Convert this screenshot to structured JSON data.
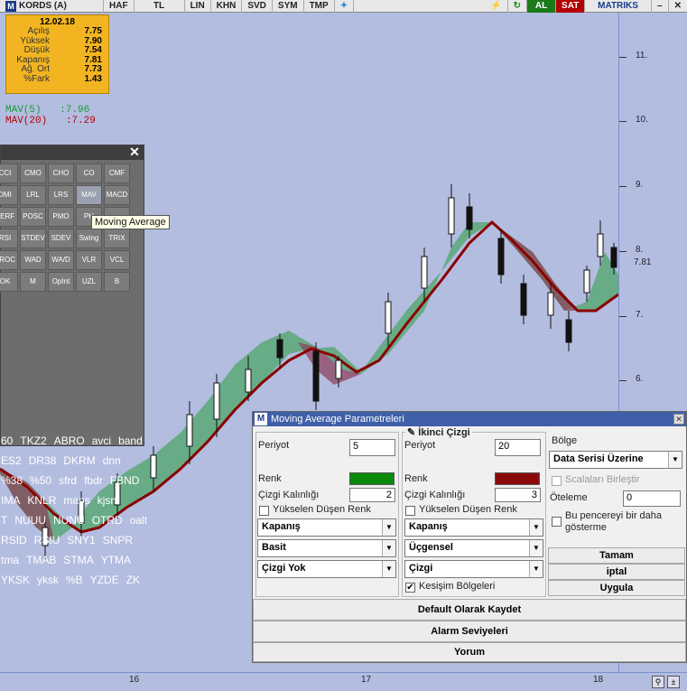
{
  "toolbar": {
    "symbol": "KORDS (A)",
    "buttons": [
      "HAF",
      "TL",
      "LIN",
      "KHN",
      "SVD",
      "SYM",
      "TMP"
    ],
    "al_label": "AL",
    "sat_label": "SAT",
    "brand": "MATRIKS"
  },
  "info_box": {
    "date": "12.02.18",
    "rows": [
      {
        "k": "Açılış",
        "v": "7.75"
      },
      {
        "k": "Yüksek",
        "v": "7.90"
      },
      {
        "k": "Düşük",
        "v": "7.54"
      },
      {
        "k": "Kapanış",
        "v": "7.81"
      },
      {
        "k": "Ağ. Ort",
        "v": "7.73"
      },
      {
        "k": "%Fark",
        "v": "1.43"
      }
    ]
  },
  "mav": {
    "mav5_label": "MAV(5)",
    "mav5_value": ":7.96",
    "mav20_label": "MAV(20)",
    "mav20_value": ":7.29",
    "mav5_color": "#1a9a3a",
    "mav20_color": "#b00000"
  },
  "y_axis": {
    "labels": [
      "11.",
      "10.",
      "9.",
      "8.",
      "7.",
      "6."
    ],
    "last_price": "7.81"
  },
  "x_axis": {
    "labels": [
      "16",
      "17",
      "18"
    ]
  },
  "indicator_panel": {
    "icons": [
      [
        "CCI",
        "CMO",
        "CHO",
        "CO",
        "CMF"
      ],
      [
        "DMI",
        "LRL",
        "LRS",
        "MAV",
        "MACD"
      ],
      [
        "PERF",
        "POSC",
        "PMO",
        "PH",
        ""
      ],
      [
        "RSI",
        "STDEV",
        "SDEV",
        "Swing",
        "TRIX"
      ],
      [
        "VROC",
        "WAD",
        "WA/D",
        "VLR",
        "VCL"
      ],
      [
        "OK",
        "M",
        "OpInt",
        "UZL",
        "B"
      ]
    ],
    "tooltip": "Moving Average",
    "words": [
      [
        "60",
        "TKZ2",
        "ABRO",
        "avci",
        "band"
      ],
      [
        "ES2",
        "DR38",
        "DKRM",
        "dnn"
      ],
      [
        "%38",
        "%50",
        "sfrd",
        "fbdr",
        "FBND"
      ],
      [
        "IMA",
        "KNLR",
        "maos",
        "kjsn"
      ],
      [
        "T",
        "NUUU",
        "NUNU",
        "OTRD",
        "oalt"
      ],
      [
        "RSID",
        "RSIU",
        "SNY1",
        "SNPR"
      ],
      [
        "tma",
        "TMAB",
        "STMA",
        "YTMA"
      ],
      [
        "YKSK",
        "yksk",
        "%B",
        "YZDE",
        "ZK"
      ]
    ]
  },
  "dialog": {
    "title": "Moving Average Parametreleri",
    "left": {
      "periyot_label": "Periyot",
      "periyot_value": "5",
      "renk_label": "Renk",
      "renk_color": "#0a8a0a",
      "kalinlik_label": "Çizgi Kalınlığı",
      "kalinlik_value": "2",
      "yukselen_label": "Yükselen Düşen Renk",
      "select1": "Kapanış",
      "select2": "Basit",
      "select3": "Çizgi Yok"
    },
    "right": {
      "heading": "İkinci Çizgi",
      "periyot_label": "Periyot",
      "periyot_value": "20",
      "renk_label": "Renk",
      "renk_color": "#8a0a0a",
      "kalinlik_label": "Çizgi Kalınlığı",
      "kalinlik_value": "3",
      "yukselen_label": "Yükselen Düşen Renk",
      "select1": "Kapanış",
      "select2": "Üçgensel",
      "select3": "Çizgi",
      "kesisim_label": "Kesişim Bölgeleri"
    },
    "bolge": {
      "label": "Bölge",
      "select": "Data Serisi Üzerine",
      "scala_label": "Scalaları Birleştir",
      "oteleme_label": "Öteleme",
      "oteleme_value": "0",
      "bu_pencere_label": "Bu pencereyi bir daha gösterme"
    },
    "buttons": {
      "tamam": "Tamam",
      "iptal": "iptal",
      "uygula": "Uygula",
      "default": "Default Olarak Kaydet",
      "alarm": "Alarm Seviyeleri",
      "yorum": "Yorum"
    }
  }
}
